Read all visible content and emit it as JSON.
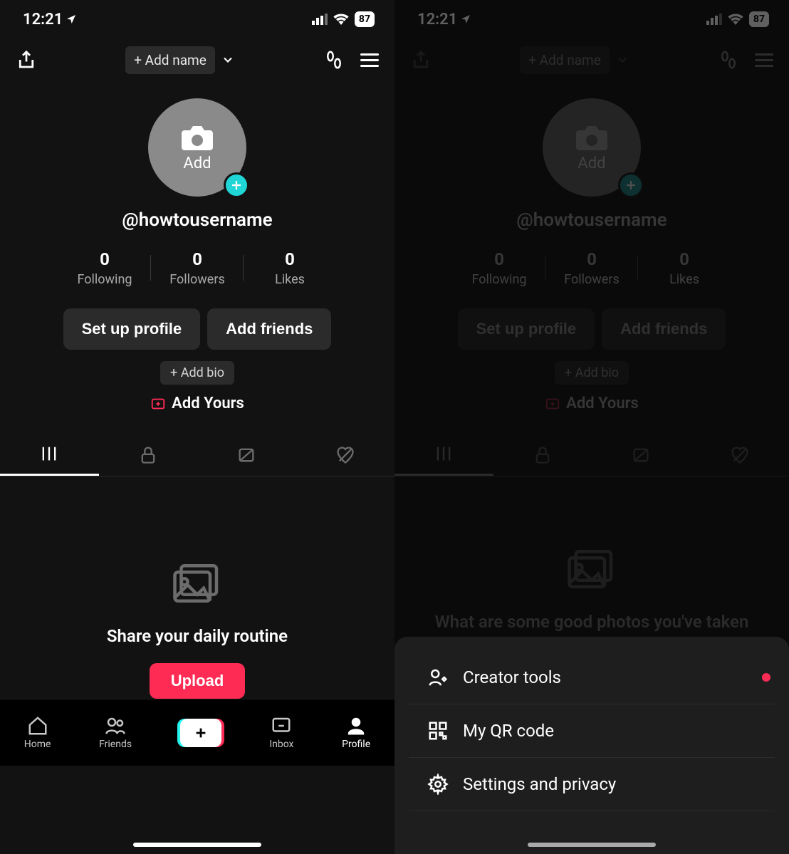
{
  "status": {
    "time": "12:21",
    "battery": "87"
  },
  "header": {
    "add_name": "+ Add name"
  },
  "profile": {
    "avatar_label": "Add",
    "username": "@howtousername",
    "stats": {
      "following_count": "0",
      "following_label": "Following",
      "followers_count": "0",
      "followers_label": "Followers",
      "likes_count": "0",
      "likes_label": "Likes"
    },
    "setup_btn": "Set up profile",
    "add_friends_btn": "Add friends",
    "add_bio": "+ Add bio",
    "add_yours": "Add Yours"
  },
  "empty_left": {
    "title": "Share your daily routine",
    "upload": "Upload"
  },
  "empty_right": {
    "title": "What are some good photos you've taken recently?"
  },
  "nav": {
    "home": "Home",
    "friends": "Friends",
    "inbox": "Inbox",
    "profile": "Profile"
  },
  "sheet": {
    "creator_tools": "Creator tools",
    "qr": "My QR code",
    "settings": "Settings and privacy"
  }
}
